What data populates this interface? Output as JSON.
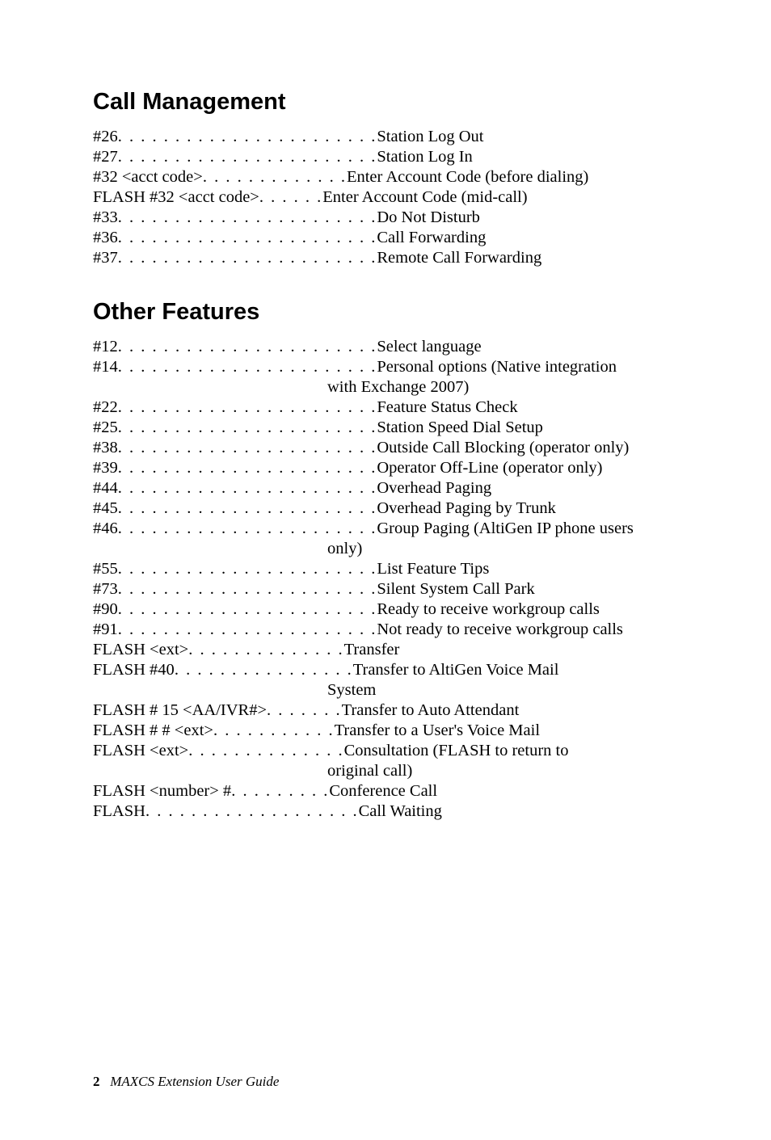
{
  "sections": [
    {
      "heading": "Call Management",
      "rows": [
        {
          "code": "#26",
          "dots": ". . . . . . . . . . . . . . . . . . . . . . .",
          "desc": "Station Log Out"
        },
        {
          "code": "#27",
          "dots": ". . . . . . . . . . . . . . . . . . . . . . .",
          "desc": "Station Log In"
        },
        {
          "code": "#32 <acct code>",
          "dots": ". . . . . . . . . . . . .",
          "desc": "Enter Account Code (before dialing)"
        },
        {
          "code": "FLASH #32 <acct code>",
          "dots": ". . . . . .",
          "desc": "Enter Account Code (mid-call)"
        },
        {
          "code": "#33",
          "dots": ". . . . . . . . . . . . . . . . . . . . . . .",
          "desc": "Do Not Disturb"
        },
        {
          "code": "#36",
          "dots": ". . . . . . . . . . . . . . . . . . . . . . .",
          "desc": "Call Forwarding"
        },
        {
          "code": "#37",
          "dots": ". . . . . . . . . . . . . . . . . . . . . . .",
          "desc": "Remote Call Forwarding"
        }
      ]
    },
    {
      "heading": "Other Features",
      "rows": [
        {
          "code": "#12",
          "dots": ". . . . . . . . . . . . . . . . . . . . . . .",
          "desc": "Select language"
        },
        {
          "code": "#14",
          "dots": ". . . . . . . . . . . . . . . . . . . . . . .",
          "desc": "Personal options (Native integration",
          "cont": "with Exchange 2007)"
        },
        {
          "code": "#22",
          "dots": ". . . . . . . . . . . . . . . . . . . . . . .",
          "desc": "Feature Status Check"
        },
        {
          "code": "#25",
          "dots": ". . . . . . . . . . . . . . . . . . . . . . .",
          "desc": "Station Speed Dial Setup"
        },
        {
          "code": "#38",
          "dots": ". . . . . . . . . . . . . . . . . . . . . . .",
          "desc": "Outside Call Blocking (operator only)"
        },
        {
          "code": "#39",
          "dots": ". . . . . . . . . . . . . . . . . . . . . . .",
          "desc": "Operator Off-Line (operator only)"
        },
        {
          "code": "#44",
          "dots": ". . . . . . . . . . . . . . . . . . . . . . .",
          "desc": "Overhead Paging"
        },
        {
          "code": "#45",
          "dots": ". . . . . . . . . . . . . . . . . . . . . . .",
          "desc": "Overhead Paging by Trunk"
        },
        {
          "code": "#46",
          "dots": ". . . . . . . . . . . . . . . . . . . . . . .",
          "desc": "Group Paging (AltiGen IP phone users",
          "cont": "only)"
        },
        {
          "code": "#55",
          "dots": ". . . . . . . . . . . . . . . . . . . . . . .",
          "desc": "List Feature Tips"
        },
        {
          "code": "#73",
          "dots": ". . . . . . . . . . . . . . . . . . . . . . .",
          "desc": "Silent System Call Park"
        },
        {
          "code": "#90",
          "dots": ". . . . . . . . . . . . . . . . . . . . . . .",
          "desc": "Ready to receive workgroup calls"
        },
        {
          "code": "#91",
          "dots": ". . . . . . . . . . . . . . . . . . . . . . .",
          "desc": "Not ready to receive workgroup calls"
        },
        {
          "code": "FLASH <ext> ",
          "dots": ". . . . . . . . . . . . . .",
          "desc": "Transfer"
        },
        {
          "code": "FLASH #40 ",
          "dots": ". . . . . . . . . . . . . . . .",
          "desc": "Transfer to AltiGen Voice Mail",
          "cont": "System"
        },
        {
          "code_html": "FLASH # 15 &lt;<span class=\"sc\">AA/IVR</span>#&gt; ",
          "dots": ". . . . . . .",
          "desc": "Transfer to Auto Attendant"
        },
        {
          "code": "FLASH # # <ext> ",
          "dots": ". . . . . . . . . . .",
          "desc": "Transfer to a User's Voice Mail"
        },
        {
          "code": "FLASH <ext> ",
          "dots": ". . . . . . . . . . . . . .",
          "desc": "Consultation (FLASH to return to",
          "cont": "original call)"
        },
        {
          "code": "FLASH <number> # ",
          "dots": ". . . . . . . . .",
          "desc": "Conference Call"
        },
        {
          "code": "FLASH  ",
          "dots": ". . . . . . . . . . . . . . . . . . .",
          "desc": "Call Waiting"
        }
      ]
    }
  ],
  "footer": {
    "page": "2",
    "title": "MAXCS Extension User Guide"
  }
}
